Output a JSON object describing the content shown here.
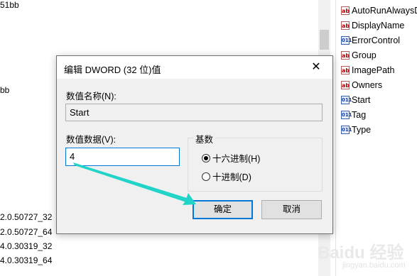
{
  "background_left": [
    "51bb",
    "bb",
    "2.0.50727_32",
    "2.0.50727_64",
    "4.0.30319_32",
    "4.0.30319_64"
  ],
  "values_panel": {
    "items": [
      {
        "name": "AutoRunAlwaysD",
        "icon": "string-value-icon"
      },
      {
        "name": "DisplayName",
        "icon": "string-value-icon"
      },
      {
        "name": "ErrorControl",
        "icon": "binary-value-icon"
      },
      {
        "name": "Group",
        "icon": "string-value-icon"
      },
      {
        "name": "ImagePath",
        "icon": "string-value-icon"
      },
      {
        "name": "Owners",
        "icon": "string-value-icon"
      },
      {
        "name": "Start",
        "icon": "binary-value-icon"
      },
      {
        "name": "Tag",
        "icon": "binary-value-icon"
      },
      {
        "name": "Type",
        "icon": "binary-value-icon"
      }
    ]
  },
  "dialog": {
    "title": "编辑 DWORD (32 位)值",
    "close_glyph": "✕",
    "value_name_label": "数值名称(N):",
    "value_name": "Start",
    "value_data_label": "数值数据(V):",
    "value_data": "4",
    "base_label": "基数",
    "base_options": [
      {
        "label": "十六进制(H)",
        "checked": true
      },
      {
        "label": "十进制(D)",
        "checked": false
      }
    ],
    "ok_label": "确定",
    "cancel_label": "取消"
  },
  "watermark": {
    "text": "Baidu 经验",
    "sub": "jingyan.baidu.com"
  },
  "colors": {
    "accent": "#0078d7",
    "annotation_arrow": "#22d3c8"
  }
}
